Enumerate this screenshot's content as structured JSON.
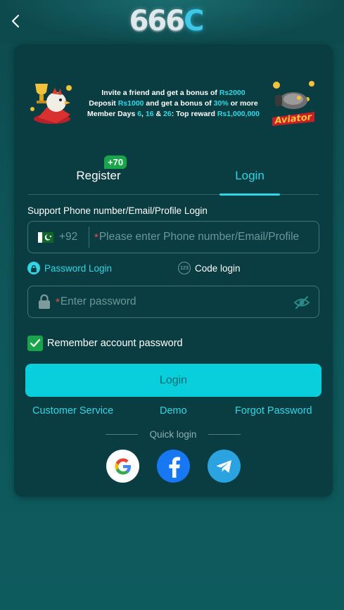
{
  "header": {
    "logo_text": "666",
    "logo_c": "C"
  },
  "banner": {
    "line1_pre": "Invite a friend and get a bonus of ",
    "line1_amount": "Rs2000",
    "line2_pre": "Deposit ",
    "line2_amount": "Rs1000",
    "line2_mid": " and get a bonus of ",
    "line2_pct": "30%",
    "line2_post": " or more",
    "line3_pre": "Member Days ",
    "line3_d1": "6",
    "line3_c1": ", ",
    "line3_d2": "16",
    "line3_c2": " & ",
    "line3_d3": "26",
    "line3_mid": ": Top reward ",
    "line3_amount": "Rs1,000,000",
    "right_art_label": "Aviator"
  },
  "tabs": {
    "register": "Register",
    "register_badge": "+70",
    "login": "Login"
  },
  "form": {
    "phone_label": "Support Phone number/Email/Profile Login",
    "country_code": "+92",
    "phone_placeholder": "Please enter Phone number/Email/Profile",
    "required_mark": "*",
    "mode_password": "Password Login",
    "mode_code": "Code login",
    "mode_code_icon_text": "123",
    "password_placeholder": "Enter password",
    "remember_label": "Remember account password",
    "remember_checked": true,
    "login_button": "Login"
  },
  "links": {
    "customer_service": "Customer Service",
    "demo": "Demo",
    "forgot_password": "Forgot Password"
  },
  "quick_login": {
    "label": "Quick login",
    "providers": [
      "google",
      "facebook",
      "telegram"
    ]
  },
  "colors": {
    "accent": "#2fd7e6",
    "button": "#08cfdb",
    "checkbox": "#19a64a",
    "card": "#0a3d41"
  }
}
